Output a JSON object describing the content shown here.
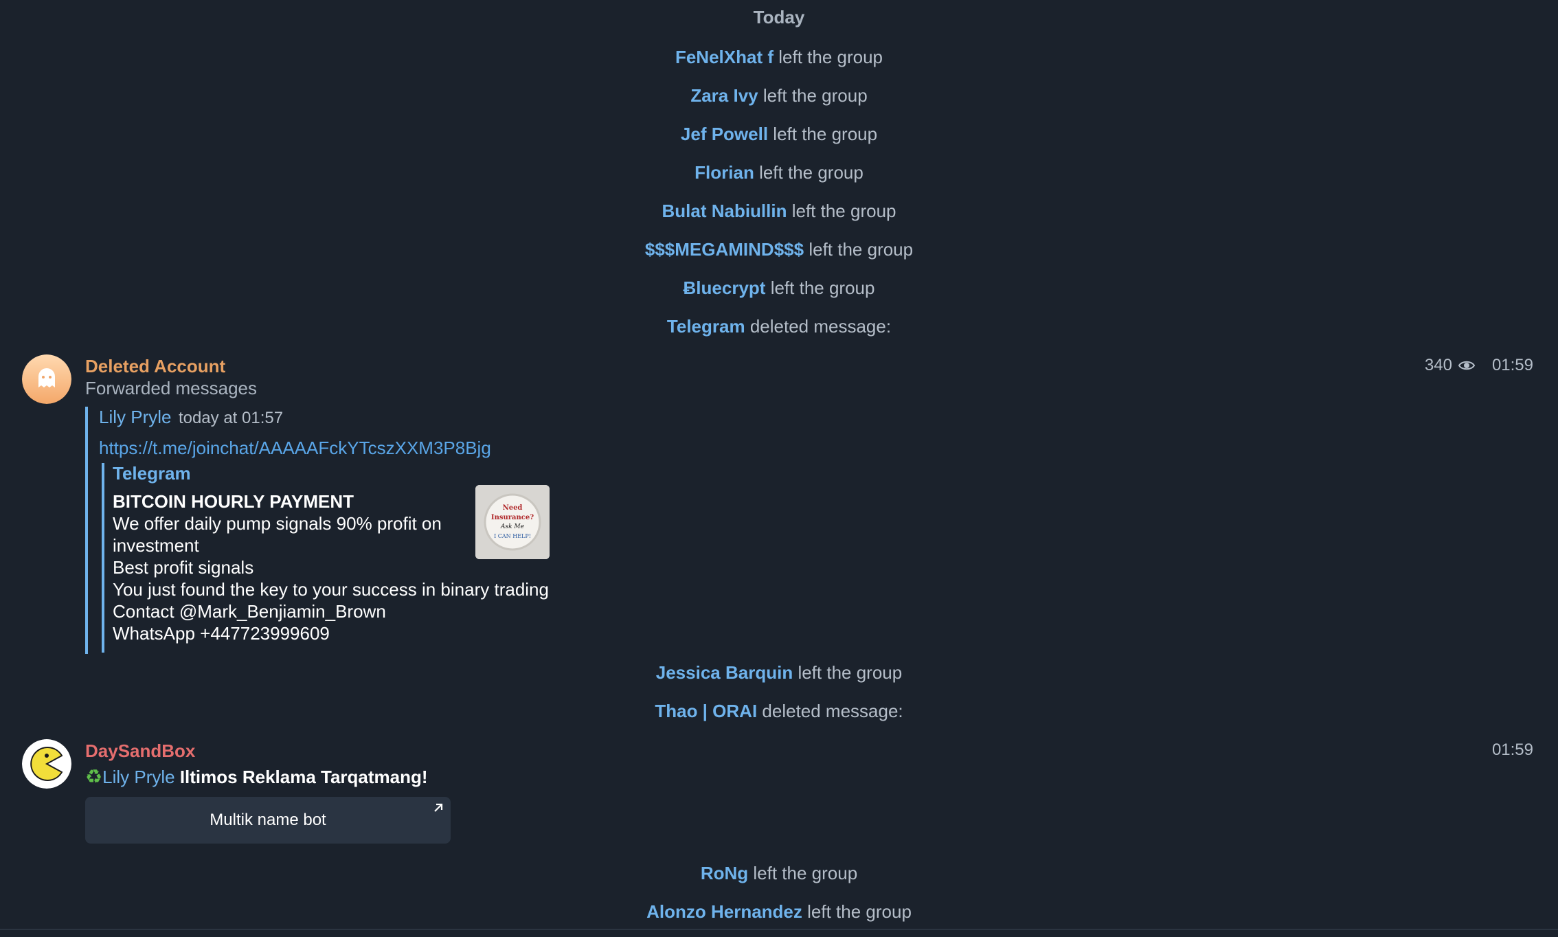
{
  "date_header": "Today",
  "events_top": [
    {
      "who": "FeNelXhat f",
      "action": "left the group"
    },
    {
      "who": "Zara Ivy",
      "action": "left the group"
    },
    {
      "who": "Jef Powell",
      "action": "left the group"
    },
    {
      "who": "Florian",
      "action": "left the group"
    },
    {
      "who": "Bulat Nabiullin",
      "action": "left the group"
    },
    {
      "who": "$$$MEGAMIND$$$",
      "action": "left the group"
    },
    {
      "who": "Ƀluecrypt",
      "action": "left the group"
    },
    {
      "who": "Telegram",
      "action": "deleted message:"
    }
  ],
  "message1": {
    "sender": "Deleted Account",
    "sender_color": "#e7a062",
    "views": "340",
    "time": "01:59",
    "forwarded_label": "Forwarded messages",
    "fwd_author": "Lily Pryle",
    "fwd_when": "today at 01:57",
    "link": "https://t.me/joinchat/AAAAAFckYTcszXXM3P8Bjg",
    "preview": {
      "site": "Telegram",
      "title": "BITCOIN HOURLY PAYMENT",
      "desc": "We offer daily pump signals 90% profit on investment",
      "lines": [
        "Best profit signals",
        "You just found the key to your success in binary trading",
        "Contact @Mark_Benjiamin_Brown",
        "WhatsApp +447723999609"
      ],
      "thumb_text": [
        "Need",
        "Insurance?",
        "Ask Me",
        "I CAN HELP!"
      ]
    }
  },
  "events_mid": [
    {
      "who": "Jessica Barquin",
      "action": "left the group"
    },
    {
      "who": "Thao | ORAI",
      "action": "deleted message:"
    }
  ],
  "message2": {
    "sender": "DaySandBox",
    "sender_color": "#e56e6e",
    "time": "01:59",
    "mention": "Lily Pryle",
    "text": "Iltimos Reklama Tarqatmang!",
    "button_label": "Multik name bot"
  },
  "events_bottom": [
    {
      "who": "RoNg",
      "action": "left the group"
    },
    {
      "who": "Alonzo Hernandez",
      "action": "left the group"
    }
  ],
  "colors": {
    "background": "#1b222c",
    "accent": "#6fb3ec"
  }
}
